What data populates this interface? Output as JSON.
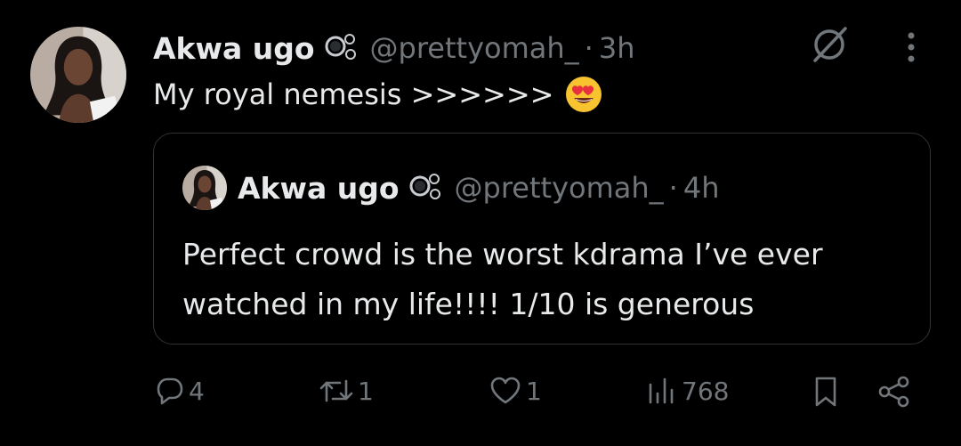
{
  "tweet": {
    "author_name": "Akwa ugo",
    "handle": "@prettyomah_",
    "separator": "·",
    "time": "3h",
    "text": "My royal nemesis >>>>>>",
    "emoji_icon": "smiling-face-with-heart-eyes-icon"
  },
  "quoted_tweet": {
    "author_name": "Akwa ugo",
    "handle": "@prettyomah_",
    "separator": "·",
    "time": "4h",
    "text": "Perfect crowd is the worst kdrama I’ve ever watched in my life!!!! 1/10 is generous"
  },
  "actions": {
    "replies": "4",
    "retweets": "1",
    "likes": "1",
    "views": "768"
  },
  "colors": {
    "background": "#000000",
    "text": "#e7e9ea",
    "muted": "#71767b",
    "border": "#2f3336"
  }
}
